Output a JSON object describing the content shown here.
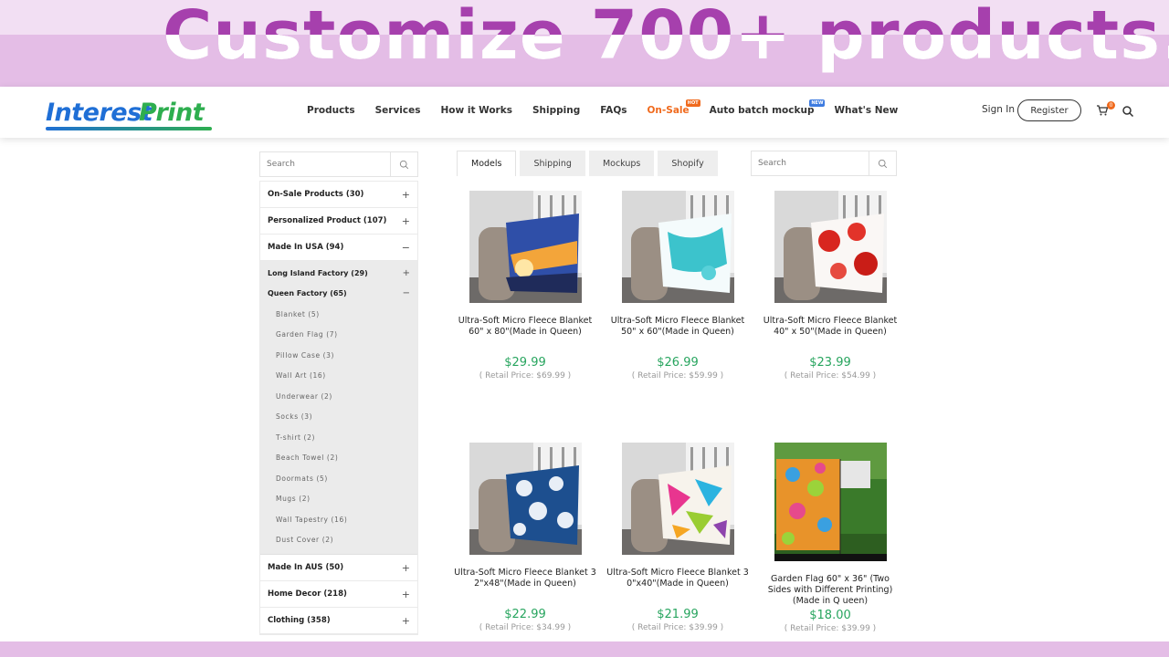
{
  "banner": {
    "headline": "Customize 700+ products."
  },
  "header": {
    "logo_part1": "Interest",
    "logo_part2": "Print",
    "nav": [
      {
        "label": "Products"
      },
      {
        "label": "Services"
      },
      {
        "label": "How it Works"
      },
      {
        "label": "Shipping"
      },
      {
        "label": "FAQs"
      },
      {
        "label": "On-Sale",
        "badge": "HOT"
      },
      {
        "label": "Auto batch mockup",
        "badge": "NEW"
      },
      {
        "label": "What's New"
      }
    ],
    "signin": "Sign In",
    "register": "Register",
    "cart_count": "0"
  },
  "sidebar": {
    "search_placeholder": "Search",
    "categories": [
      {
        "label": "On-Sale Products  (30)",
        "toggle": "+"
      },
      {
        "label": "Personalized Product  (107)",
        "toggle": "+"
      },
      {
        "label": "Made In USA  (94)",
        "toggle": "−"
      }
    ],
    "subcategories": [
      {
        "label": "Long Island Factory  (29)",
        "toggle": "+"
      },
      {
        "label": "Queen Factory  (65)",
        "toggle": "−"
      }
    ],
    "leaves": [
      "Blanket  (5)",
      "Garden Flag  (7)",
      "Pillow Case  (3)",
      "Wall Art  (16)",
      "Underwear  (2)",
      "Socks  (3)",
      "T-shirt  (2)",
      "Beach Towel  (2)",
      "Doormats  (5)",
      "Mugs  (2)",
      "Wall Tapestry  (16)",
      "Dust Cover  (2)"
    ],
    "bottom_categories": [
      {
        "label": "Made In AUS  (50)",
        "toggle": "+"
      },
      {
        "label": "Home Decor  (218)",
        "toggle": "+"
      },
      {
        "label": "Clothing  (358)",
        "toggle": "+"
      }
    ]
  },
  "tabs": [
    "Models",
    "Shipping",
    "Mockups",
    "Shopify"
  ],
  "tab_search_placeholder": "Search",
  "products": [
    {
      "name": "Ultra-Soft Micro Fleece Blanket 60\" x 80\"(Made in Queen)",
      "price": "$29.99",
      "retail": "( Retail Price: $69.99 )"
    },
    {
      "name": "Ultra-Soft Micro Fleece Blanket 50\" x 60\"(Made in Queen)",
      "price": "$26.99",
      "retail": "( Retail Price: $59.99 )"
    },
    {
      "name": "Ultra-Soft Micro Fleece Blanket 40\" x 50\"(Made in Queen)",
      "price": "$23.99",
      "retail": "( Retail Price: $54.99 )"
    },
    {
      "name": "Ultra-Soft Micro Fleece Blanket 3 2\"x48\"(Made in Queen)",
      "price": "$22.99",
      "retail": "( Retail Price: $34.99 )"
    },
    {
      "name": "Ultra-Soft Micro Fleece Blanket 3 0\"x40\"(Made in Queen)",
      "price": "$21.99",
      "retail": "( Retail Price: $39.99 )"
    },
    {
      "name": "Garden Flag 60\" x 36\" (Two Sides with Different Printing)(Made in Q ueen)",
      "price": "$18.00",
      "retail": "( Retail Price: $39.99 )"
    }
  ],
  "colors": {
    "accent": "#f06a1d",
    "price": "#28a55f",
    "banner": "#e4bde6",
    "headline": "#a640ad"
  }
}
